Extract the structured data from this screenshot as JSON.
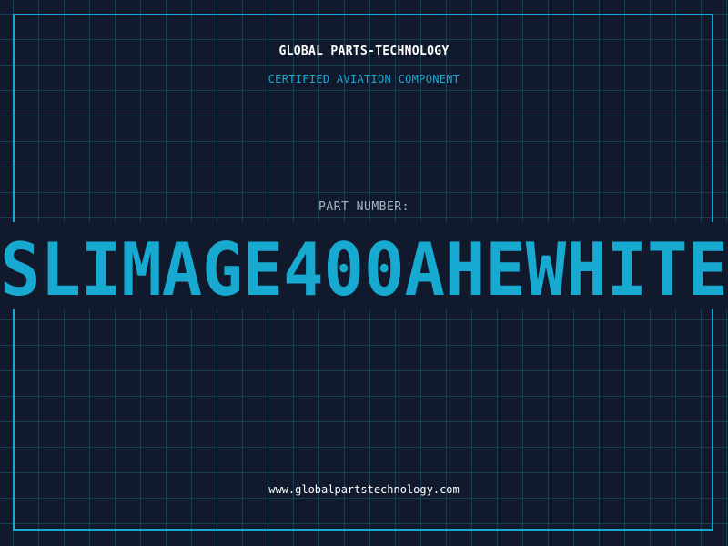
{
  "header": {
    "company": "GLOBAL PARTS-TECHNOLOGY",
    "subtitle": "CERTIFIED AVIATION COMPONENT"
  },
  "part": {
    "label": "PART NUMBER:",
    "number": "SLIMAGE400AHEWHITE"
  },
  "footer": {
    "website": "www.globalpartstechnology.com"
  },
  "colors": {
    "background": "#111a2c",
    "grid": "#1d3d57",
    "accent": "#17a9cf",
    "text": "#ffffff",
    "muted": "#a6b2c2"
  }
}
